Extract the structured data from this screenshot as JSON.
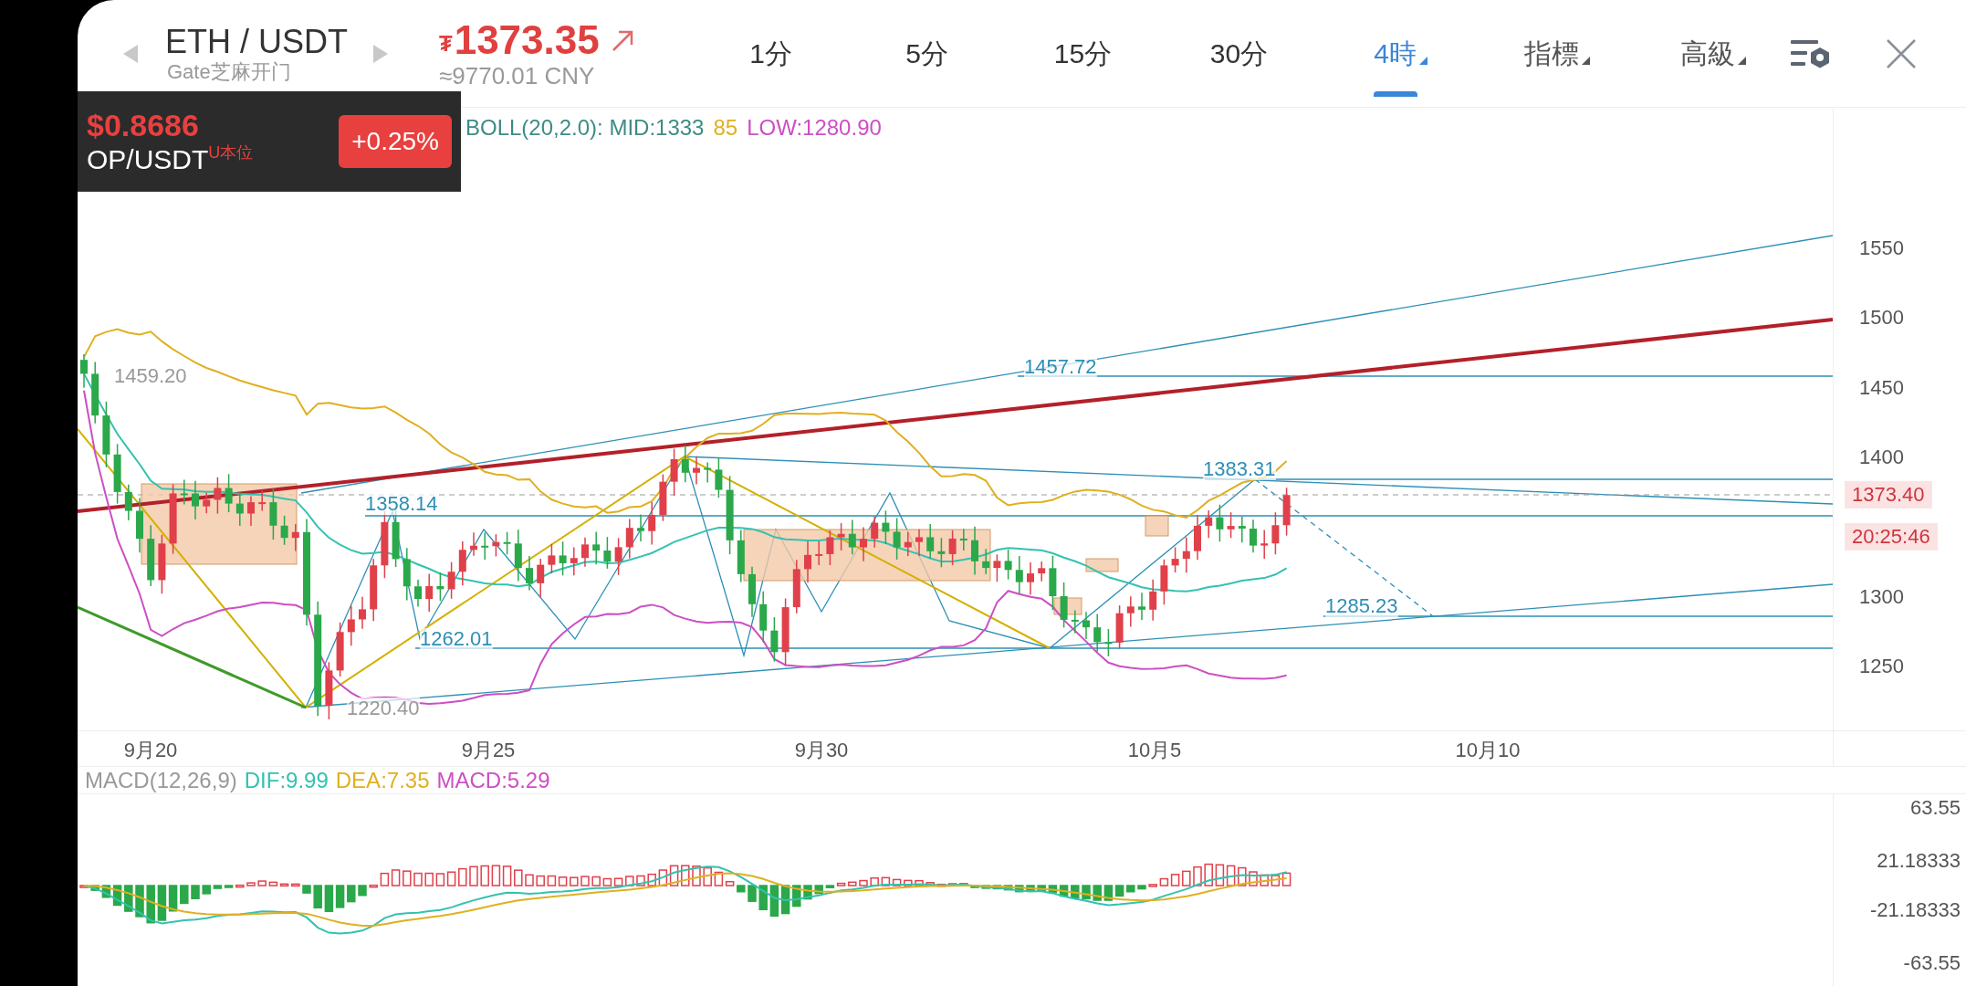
{
  "header": {
    "pair": "ETH / USDT",
    "exchange": "Gate芝麻开门",
    "currency_symbol": "₮",
    "price": "1373.35",
    "converted": "≈9770.01 CNY"
  },
  "tabs": [
    {
      "label": "1分",
      "selected": false,
      "dropdown": false
    },
    {
      "label": "5分",
      "selected": false,
      "dropdown": false
    },
    {
      "label": "15分",
      "selected": false,
      "dropdown": false
    },
    {
      "label": "30分",
      "selected": false,
      "dropdown": false
    },
    {
      "label": "4時",
      "selected": true,
      "dropdown": true
    },
    {
      "label": "指標",
      "selected": false,
      "dropdown": true
    },
    {
      "label": "高級",
      "selected": false,
      "dropdown": true
    }
  ],
  "floating_ticker": {
    "price": "$0.8686",
    "pair": "OP/USDT",
    "tag": "U本位",
    "change": "+0.25%"
  },
  "boll_legend": [
    {
      "text": "BOLL(20,2.0): MID:1333",
      "color": "#3d8c86"
    },
    {
      "text": "85",
      "color": "#e0b020"
    },
    {
      "text": "LOW:1280.90",
      "color": "#cc4fc4"
    }
  ],
  "price_axis": [
    "1550",
    "1500",
    "1450",
    "1400",
    "1300",
    "1250"
  ],
  "price_tags": [
    {
      "text": "1373.40",
      "kind": "price"
    },
    {
      "text": "20:25:46",
      "kind": "countdown"
    }
  ],
  "annotations": [
    "1459.20",
    "1457.72",
    "1358.14",
    "1383.31",
    "1262.01",
    "1285.23",
    "1220.40"
  ],
  "date_axis": [
    "9月20",
    "9月25",
    "9月30",
    "10月5",
    "10月10"
  ],
  "macd_legend": [
    {
      "text": "MACD(12,26,9)",
      "color": "#999999"
    },
    {
      "text": "DIF:9.99",
      "color": "#33c2b0"
    },
    {
      "text": "DEA:7.35",
      "color": "#e0b020"
    },
    {
      "text": "MACD:5.29",
      "color": "#cc4fc4"
    }
  ],
  "macd_axis": [
    "63.55",
    "21.18333",
    "-21.18333",
    "-63.55"
  ]
}
